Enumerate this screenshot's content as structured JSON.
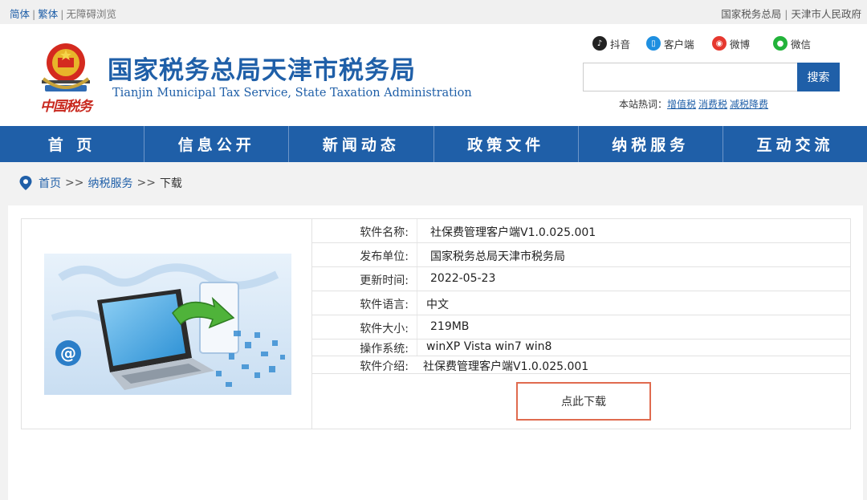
{
  "topbar": {
    "simplified": "简体",
    "traditional": "繁体",
    "accessible": "无障碍浏览",
    "link_sat": "国家税务总局",
    "link_gov": "天津市人民政府"
  },
  "header": {
    "seal_text": "中国税务",
    "title_cn": "国家税务总局天津市税务局",
    "title_en": "Tianjin Municipal Tax Service, State Taxation Administration",
    "social": {
      "douyin": "抖音",
      "client": "客户端",
      "weibo": "微博",
      "wechat": "微信"
    },
    "search_button": "搜索",
    "hot_label": "本站热词：",
    "hot_words": [
      "增值税",
      "消费税",
      "减税降费"
    ]
  },
  "nav": [
    "首 页",
    "信息公开",
    "新闻动态",
    "政策文件",
    "纳税服务",
    "互动交流"
  ],
  "breadcrumb": {
    "home": "首页",
    "sep1": ">>",
    "section": "纳税服务",
    "sep2": ">>",
    "current": "下载"
  },
  "download": {
    "rows": [
      {
        "label": "软件名称:",
        "value": "社保费管理客户端V1.0.025.001"
      },
      {
        "label": "发布单位:",
        "value": "国家税务总局天津市税务局"
      },
      {
        "label": "更新时间:",
        "value": "2022-05-23"
      },
      {
        "label": "软件语言:",
        "value": "中文"
      },
      {
        "label": "软件大小:",
        "value": "219MB"
      },
      {
        "label": "操作系统:",
        "value": "winXP Vista win7 win8"
      },
      {
        "label": "软件介绍:",
        "value": "社保费管理客户端V1.0.025.001"
      }
    ],
    "button": "点此下载"
  },
  "colors": {
    "brand_blue": "#1f5fa8",
    "seal_red": "#c8281e",
    "button_border": "#e06b4f"
  }
}
